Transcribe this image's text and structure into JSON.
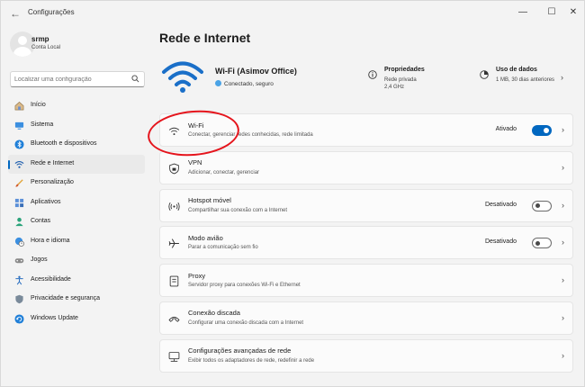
{
  "window": {
    "title": "Configurações",
    "back_glyph": "←",
    "min_glyph": "—",
    "max_glyph": "☐",
    "close_glyph": "✕"
  },
  "user": {
    "name": "srmp",
    "account": "Conta Local"
  },
  "search": {
    "placeholder": "Localizar uma configuração"
  },
  "sidebar": {
    "items": [
      {
        "label": "Início",
        "icon": "home-icon",
        "active": false
      },
      {
        "label": "Sistema",
        "icon": "monitor-icon",
        "active": false
      },
      {
        "label": "Bluetooth e dispositivos",
        "icon": "bluetooth-icon",
        "active": false
      },
      {
        "label": "Rede e Internet",
        "icon": "wifi-icon",
        "active": true
      },
      {
        "label": "Personalização",
        "icon": "brush-icon",
        "active": false
      },
      {
        "label": "Aplicativos",
        "icon": "apps-icon",
        "active": false
      },
      {
        "label": "Contas",
        "icon": "person-icon",
        "active": false
      },
      {
        "label": "Hora e idioma",
        "icon": "globe-clock-icon",
        "active": false
      },
      {
        "label": "Jogos",
        "icon": "gamepad-icon",
        "active": false
      },
      {
        "label": "Acessibilidade",
        "icon": "accessibility-icon",
        "active": false
      },
      {
        "label": "Privacidade e segurança",
        "icon": "shield-icon",
        "active": false
      },
      {
        "label": "Windows Update",
        "icon": "update-icon",
        "active": false
      }
    ]
  },
  "main": {
    "title": "Rede e Internet",
    "network": {
      "name": "Wi-Fi (Asimov Office)",
      "status": "Conectado, seguro"
    },
    "properties": {
      "title": "Propriedades",
      "line1": "Rede privada",
      "line2": "2,4 GHz"
    },
    "data_usage": {
      "title": "Uso de dados",
      "line1": "1 MB, 30 dias anteriores"
    },
    "rows": [
      {
        "title": "Wi-Fi",
        "subtitle": "Conectar, gerenciar redes conhecidas, rede limitada",
        "state": "Ativado",
        "toggle": "on",
        "icon": "wifi-icon"
      },
      {
        "title": "VPN",
        "subtitle": "Adicionar, conectar, gerenciar",
        "state": "",
        "toggle": "none",
        "icon": "vpn-shield-icon"
      },
      {
        "title": "Hotspot móvel",
        "subtitle": "Compartilhar sua conexão com a Internet",
        "state": "Desativado",
        "toggle": "off",
        "icon": "hotspot-icon"
      },
      {
        "title": "Modo avião",
        "subtitle": "Parar a comunicação sem fio",
        "state": "Desativado",
        "toggle": "off",
        "icon": "airplane-icon"
      },
      {
        "title": "Proxy",
        "subtitle": "Servidor proxy para conexões Wi-Fi e Ethernet",
        "state": "",
        "toggle": "none",
        "icon": "proxy-icon"
      },
      {
        "title": "Conexão discada",
        "subtitle": "Configurar uma conexão discada com a Internet",
        "state": "",
        "toggle": "none",
        "icon": "dialup-icon"
      },
      {
        "title": "Configurações avançadas de rede",
        "subtitle": "Exibir todos os adaptadores de rede, redefinir a rede",
        "state": "",
        "toggle": "none",
        "icon": "network-adapter-icon"
      }
    ]
  },
  "colors": {
    "accent": "#0067c0",
    "annotation": "#e5141c"
  }
}
